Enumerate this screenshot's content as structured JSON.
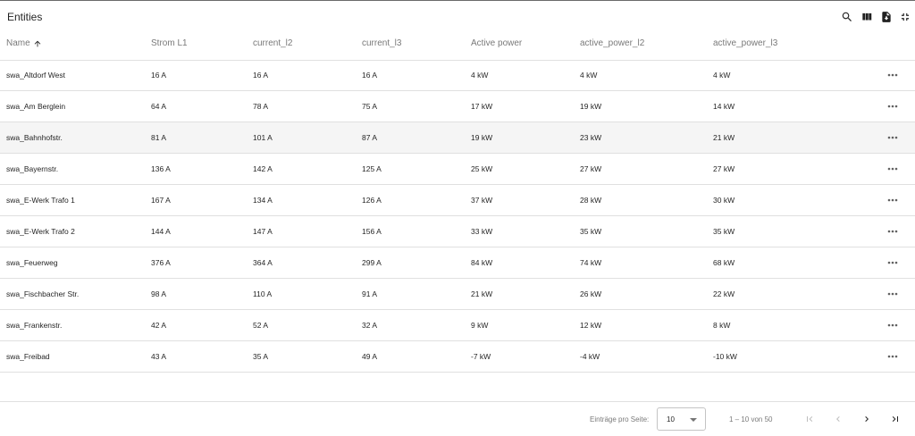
{
  "header": {
    "title": "Entities",
    "icons": [
      "search-icon",
      "columns-icon",
      "export-document-icon",
      "fullscreen-exit-icon"
    ]
  },
  "columns": {
    "name": "Name",
    "c1": "Strom L1",
    "c2": "current_l2",
    "c3": "current_l3",
    "c4": "Active power",
    "c5": "active_power_l2",
    "c6": "active_power_l3",
    "sort_icon": "arrow-upward-icon"
  },
  "rows": [
    {
      "name": "swa_Altdorf West",
      "c1": "16 A",
      "c2": "16 A",
      "c3": "16 A",
      "c4": "4 kW",
      "c5": "4 kW",
      "c6": "4 kW"
    },
    {
      "name": "swa_Am Berglein",
      "c1": "64 A",
      "c2": "78 A",
      "c3": "75 A",
      "c4": "17 kW",
      "c5": "19 kW",
      "c6": "14 kW"
    },
    {
      "name": "swa_Bahnhofstr.",
      "c1": "81 A",
      "c2": "101 A",
      "c3": "87 A",
      "c4": "19 kW",
      "c5": "23 kW",
      "c6": "21 kW"
    },
    {
      "name": "swa_Bayernstr.",
      "c1": "136 A",
      "c2": "142 A",
      "c3": "125 A",
      "c4": "25 kW",
      "c5": "27 kW",
      "c6": "27 kW"
    },
    {
      "name": "swa_E-Werk Trafo 1",
      "c1": "167 A",
      "c2": "134 A",
      "c3": "126 A",
      "c4": "37 kW",
      "c5": "28 kW",
      "c6": "30 kW"
    },
    {
      "name": "swa_E-Werk Trafo 2",
      "c1": "144 A",
      "c2": "147 A",
      "c3": "156 A",
      "c4": "33 kW",
      "c5": "35 kW",
      "c6": "35 kW"
    },
    {
      "name": "swa_Feuerweg",
      "c1": "376 A",
      "c2": "364 A",
      "c3": "299 A",
      "c4": "84 kW",
      "c5": "74 kW",
      "c6": "68 kW"
    },
    {
      "name": "swa_Fischbacher Str.",
      "c1": "98 A",
      "c2": "110 A",
      "c3": "91 A",
      "c4": "21 kW",
      "c5": "26 kW",
      "c6": "22 kW"
    },
    {
      "name": "swa_Frankenstr.",
      "c1": "42 A",
      "c2": "52 A",
      "c3": "32 A",
      "c4": "9 kW",
      "c5": "12 kW",
      "c6": "8 kW"
    },
    {
      "name": "swa_Freibad",
      "c1": "43 A",
      "c2": "35 A",
      "c3": "49 A",
      "c4": "-7 kW",
      "c5": "-4 kW",
      "c6": "-10 kW"
    }
  ],
  "row_action_icon": "more-horiz-icon",
  "highlighted_row": 2,
  "paginator": {
    "per_page_label": "Einträge pro Seite:",
    "per_page_value": "10",
    "range_label": "1 – 10 von 50",
    "icons": [
      "first-page-icon",
      "previous-page-icon",
      "next-page-icon",
      "last-page-icon"
    ]
  },
  "colors": {
    "text": "#212121",
    "secondary_text": "#757575",
    "divider": "#e0e0e0",
    "row_highlight": "#f5f5f5",
    "disabled_icon": "#bdbdbd"
  }
}
